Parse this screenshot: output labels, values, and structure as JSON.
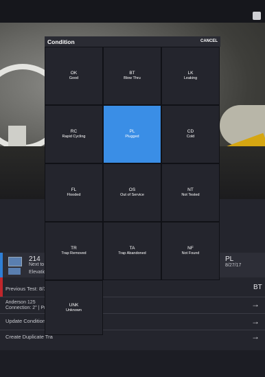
{
  "dialog": {
    "title": "Condition",
    "cancel_label": "CANCEL",
    "selected_code": "PL",
    "options": [
      {
        "code": "OK",
        "label": "Good"
      },
      {
        "code": "BT",
        "label": "Blow Thru"
      },
      {
        "code": "LK",
        "label": "Leaking"
      },
      {
        "code": "RC",
        "label": "Rapid Cycling"
      },
      {
        "code": "PL",
        "label": "Plugged"
      },
      {
        "code": "CD",
        "label": "Cold"
      },
      {
        "code": "FL",
        "label": "Flooded"
      },
      {
        "code": "OS",
        "label": "Out of Service"
      },
      {
        "code": "NT",
        "label": "Not Tested"
      },
      {
        "code": "TR",
        "label": "Trap Removed"
      },
      {
        "code": "TA",
        "label": "Trap Abandoned"
      },
      {
        "code": "NF",
        "label": "Not Found"
      },
      {
        "code": "UNK",
        "label": "Unknown"
      }
    ]
  },
  "background": {
    "trap_number": "214",
    "next_to": "Next to lo",
    "elevation": "Elevation:",
    "condition_code": "PL",
    "date": "8/27/17",
    "previous_test": "Previous Test: 8/30",
    "previous_condition": "BT",
    "location_line1": "Anderson 125",
    "location_line2": "Connection: 2\" | Press",
    "update_label": "Update Condition M",
    "duplicate_label": "Create Duplicate Tra"
  },
  "colors": {
    "accent": "#3a8ee6",
    "tile": "#24252d"
  }
}
